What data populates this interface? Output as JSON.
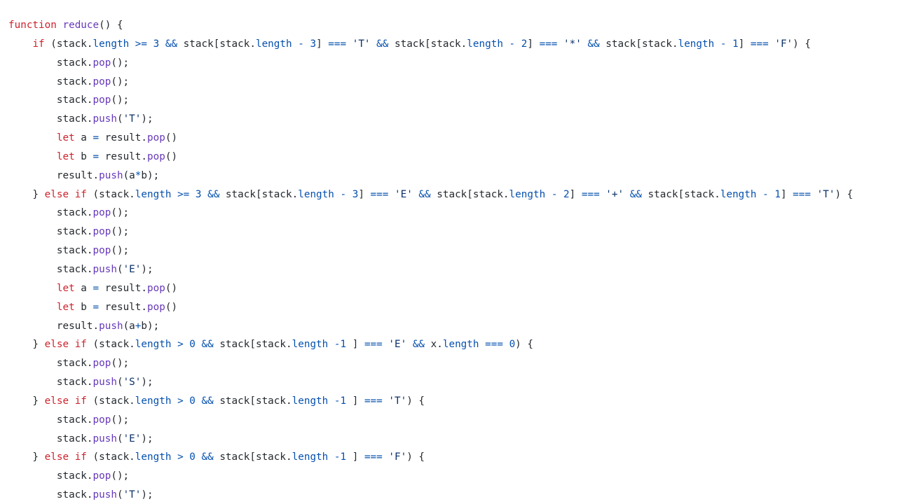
{
  "editor": {
    "lines": [
      [
        [
          "keyword",
          "function"
        ],
        [
          "plain",
          " "
        ],
        [
          "function",
          "reduce"
        ],
        [
          "plain",
          "() {"
        ]
      ],
      [
        [
          "plain",
          "    "
        ],
        [
          "keyword",
          "if"
        ],
        [
          "plain",
          " (stack."
        ],
        [
          "property",
          "length"
        ],
        [
          "plain",
          " "
        ],
        [
          "operator",
          ">="
        ],
        [
          "plain",
          " "
        ],
        [
          "number",
          "3"
        ],
        [
          "plain",
          " "
        ],
        [
          "operator",
          "&&"
        ],
        [
          "plain",
          " stack[stack."
        ],
        [
          "property",
          "length"
        ],
        [
          "plain",
          " "
        ],
        [
          "operator",
          "-"
        ],
        [
          "plain",
          " "
        ],
        [
          "number",
          "3"
        ],
        [
          "plain",
          "] "
        ],
        [
          "operator",
          "==="
        ],
        [
          "plain",
          " "
        ],
        [
          "string",
          "'T'"
        ],
        [
          "plain",
          " "
        ],
        [
          "operator",
          "&&"
        ],
        [
          "plain",
          " stack[stack."
        ],
        [
          "property",
          "length"
        ],
        [
          "plain",
          " "
        ],
        [
          "operator",
          "-"
        ],
        [
          "plain",
          " "
        ],
        [
          "number",
          "2"
        ],
        [
          "plain",
          "] "
        ],
        [
          "operator",
          "==="
        ],
        [
          "plain",
          " "
        ],
        [
          "string",
          "'*'"
        ],
        [
          "plain",
          " "
        ],
        [
          "operator",
          "&&"
        ],
        [
          "plain",
          " stack[stack."
        ],
        [
          "property",
          "length"
        ],
        [
          "plain",
          " "
        ],
        [
          "operator",
          "-"
        ],
        [
          "plain",
          " "
        ],
        [
          "number",
          "1"
        ],
        [
          "plain",
          "] "
        ],
        [
          "operator",
          "==="
        ],
        [
          "plain",
          " "
        ],
        [
          "string",
          "'F'"
        ],
        [
          "plain",
          ") {"
        ]
      ],
      [
        [
          "plain",
          "        stack."
        ],
        [
          "function",
          "pop"
        ],
        [
          "plain",
          "();"
        ]
      ],
      [
        [
          "plain",
          "        stack."
        ],
        [
          "function",
          "pop"
        ],
        [
          "plain",
          "();"
        ]
      ],
      [
        [
          "plain",
          "        stack."
        ],
        [
          "function",
          "pop"
        ],
        [
          "plain",
          "();"
        ]
      ],
      [
        [
          "plain",
          "        stack."
        ],
        [
          "function",
          "push"
        ],
        [
          "plain",
          "("
        ],
        [
          "string",
          "'T'"
        ],
        [
          "plain",
          ");"
        ]
      ],
      [
        [
          "plain",
          "        "
        ],
        [
          "keyword",
          "let"
        ],
        [
          "plain",
          " a "
        ],
        [
          "operator",
          "="
        ],
        [
          "plain",
          " result."
        ],
        [
          "function",
          "pop"
        ],
        [
          "plain",
          "()"
        ]
      ],
      [
        [
          "plain",
          "        "
        ],
        [
          "keyword",
          "let"
        ],
        [
          "plain",
          " b "
        ],
        [
          "operator",
          "="
        ],
        [
          "plain",
          " result."
        ],
        [
          "function",
          "pop"
        ],
        [
          "plain",
          "()"
        ]
      ],
      [
        [
          "plain",
          "        result."
        ],
        [
          "function",
          "push"
        ],
        [
          "plain",
          "(a"
        ],
        [
          "operator",
          "*"
        ],
        [
          "plain",
          "b);"
        ]
      ],
      [
        [
          "plain",
          "    } "
        ],
        [
          "keyword",
          "else"
        ],
        [
          "plain",
          " "
        ],
        [
          "keyword",
          "if"
        ],
        [
          "plain",
          " (stack."
        ],
        [
          "property",
          "length"
        ],
        [
          "plain",
          " "
        ],
        [
          "operator",
          ">="
        ],
        [
          "plain",
          " "
        ],
        [
          "number",
          "3"
        ],
        [
          "plain",
          " "
        ],
        [
          "operator",
          "&&"
        ],
        [
          "plain",
          " stack[stack."
        ],
        [
          "property",
          "length"
        ],
        [
          "plain",
          " "
        ],
        [
          "operator",
          "-"
        ],
        [
          "plain",
          " "
        ],
        [
          "number",
          "3"
        ],
        [
          "plain",
          "] "
        ],
        [
          "operator",
          "==="
        ],
        [
          "plain",
          " "
        ],
        [
          "string",
          "'E'"
        ],
        [
          "plain",
          " "
        ],
        [
          "operator",
          "&&"
        ],
        [
          "plain",
          " stack[stack."
        ],
        [
          "property",
          "length"
        ],
        [
          "plain",
          " "
        ],
        [
          "operator",
          "-"
        ],
        [
          "plain",
          " "
        ],
        [
          "number",
          "2"
        ],
        [
          "plain",
          "] "
        ],
        [
          "operator",
          "==="
        ],
        [
          "plain",
          " "
        ],
        [
          "string",
          "'+'"
        ],
        [
          "plain",
          " "
        ],
        [
          "operator",
          "&&"
        ],
        [
          "plain",
          " stack[stack."
        ],
        [
          "property",
          "length"
        ],
        [
          "plain",
          " "
        ],
        [
          "operator",
          "-"
        ],
        [
          "plain",
          " "
        ],
        [
          "number",
          "1"
        ],
        [
          "plain",
          "] "
        ],
        [
          "operator",
          "==="
        ],
        [
          "plain",
          " "
        ],
        [
          "string",
          "'T'"
        ],
        [
          "plain",
          ") {"
        ]
      ],
      [
        [
          "plain",
          "        stack."
        ],
        [
          "function",
          "pop"
        ],
        [
          "plain",
          "();"
        ]
      ],
      [
        [
          "plain",
          "        stack."
        ],
        [
          "function",
          "pop"
        ],
        [
          "plain",
          "();"
        ]
      ],
      [
        [
          "plain",
          "        stack."
        ],
        [
          "function",
          "pop"
        ],
        [
          "plain",
          "();"
        ]
      ],
      [
        [
          "plain",
          "        stack."
        ],
        [
          "function",
          "push"
        ],
        [
          "plain",
          "("
        ],
        [
          "string",
          "'E'"
        ],
        [
          "plain",
          ");"
        ]
      ],
      [
        [
          "plain",
          "        "
        ],
        [
          "keyword",
          "let"
        ],
        [
          "plain",
          " a "
        ],
        [
          "operator",
          "="
        ],
        [
          "plain",
          " result."
        ],
        [
          "function",
          "pop"
        ],
        [
          "plain",
          "()"
        ]
      ],
      [
        [
          "plain",
          "        "
        ],
        [
          "keyword",
          "let"
        ],
        [
          "plain",
          " b "
        ],
        [
          "operator",
          "="
        ],
        [
          "plain",
          " result."
        ],
        [
          "function",
          "pop"
        ],
        [
          "plain",
          "()"
        ]
      ],
      [
        [
          "plain",
          "        result."
        ],
        [
          "function",
          "push"
        ],
        [
          "plain",
          "(a"
        ],
        [
          "operator",
          "+"
        ],
        [
          "plain",
          "b);"
        ]
      ],
      [
        [
          "plain",
          "    } "
        ],
        [
          "keyword",
          "else"
        ],
        [
          "plain",
          " "
        ],
        [
          "keyword",
          "if"
        ],
        [
          "plain",
          " (stack."
        ],
        [
          "property",
          "length"
        ],
        [
          "plain",
          " "
        ],
        [
          "operator",
          ">"
        ],
        [
          "plain",
          " "
        ],
        [
          "number",
          "0"
        ],
        [
          "plain",
          " "
        ],
        [
          "operator",
          "&&"
        ],
        [
          "plain",
          " stack[stack."
        ],
        [
          "property",
          "length"
        ],
        [
          "plain",
          " "
        ],
        [
          "operator",
          "-"
        ],
        [
          "number",
          "1"
        ],
        [
          "plain",
          " ] "
        ],
        [
          "operator",
          "==="
        ],
        [
          "plain",
          " "
        ],
        [
          "string",
          "'E'"
        ],
        [
          "plain",
          " "
        ],
        [
          "operator",
          "&&"
        ],
        [
          "plain",
          " x."
        ],
        [
          "property",
          "length"
        ],
        [
          "plain",
          " "
        ],
        [
          "operator",
          "==="
        ],
        [
          "plain",
          " "
        ],
        [
          "number",
          "0"
        ],
        [
          "plain",
          ") {"
        ]
      ],
      [
        [
          "plain",
          "        stack."
        ],
        [
          "function",
          "pop"
        ],
        [
          "plain",
          "();"
        ]
      ],
      [
        [
          "plain",
          "        stack."
        ],
        [
          "function",
          "push"
        ],
        [
          "plain",
          "("
        ],
        [
          "string",
          "'S'"
        ],
        [
          "plain",
          ");"
        ]
      ],
      [
        [
          "plain",
          "    } "
        ],
        [
          "keyword",
          "else"
        ],
        [
          "plain",
          " "
        ],
        [
          "keyword",
          "if"
        ],
        [
          "plain",
          " (stack."
        ],
        [
          "property",
          "length"
        ],
        [
          "plain",
          " "
        ],
        [
          "operator",
          ">"
        ],
        [
          "plain",
          " "
        ],
        [
          "number",
          "0"
        ],
        [
          "plain",
          " "
        ],
        [
          "operator",
          "&&"
        ],
        [
          "plain",
          " stack[stack."
        ],
        [
          "property",
          "length"
        ],
        [
          "plain",
          " "
        ],
        [
          "operator",
          "-"
        ],
        [
          "number",
          "1"
        ],
        [
          "plain",
          " ] "
        ],
        [
          "operator",
          "==="
        ],
        [
          "plain",
          " "
        ],
        [
          "string",
          "'T'"
        ],
        [
          "plain",
          ") {"
        ]
      ],
      [
        [
          "plain",
          "        stack."
        ],
        [
          "function",
          "pop"
        ],
        [
          "plain",
          "();"
        ]
      ],
      [
        [
          "plain",
          "        stack."
        ],
        [
          "function",
          "push"
        ],
        [
          "plain",
          "("
        ],
        [
          "string",
          "'E'"
        ],
        [
          "plain",
          ");"
        ]
      ],
      [
        [
          "plain",
          "    } "
        ],
        [
          "keyword",
          "else"
        ],
        [
          "plain",
          " "
        ],
        [
          "keyword",
          "if"
        ],
        [
          "plain",
          " (stack."
        ],
        [
          "property",
          "length"
        ],
        [
          "plain",
          " "
        ],
        [
          "operator",
          ">"
        ],
        [
          "plain",
          " "
        ],
        [
          "number",
          "0"
        ],
        [
          "plain",
          " "
        ],
        [
          "operator",
          "&&"
        ],
        [
          "plain",
          " stack[stack."
        ],
        [
          "property",
          "length"
        ],
        [
          "plain",
          " "
        ],
        [
          "operator",
          "-"
        ],
        [
          "number",
          "1"
        ],
        [
          "plain",
          " ] "
        ],
        [
          "operator",
          "==="
        ],
        [
          "plain",
          " "
        ],
        [
          "string",
          "'F'"
        ],
        [
          "plain",
          ") {"
        ]
      ],
      [
        [
          "plain",
          "        stack."
        ],
        [
          "function",
          "pop"
        ],
        [
          "plain",
          "();"
        ]
      ],
      [
        [
          "plain",
          "        stack."
        ],
        [
          "function",
          "push"
        ],
        [
          "plain",
          "("
        ],
        [
          "string",
          "'T'"
        ],
        [
          "plain",
          ");"
        ]
      ]
    ]
  }
}
